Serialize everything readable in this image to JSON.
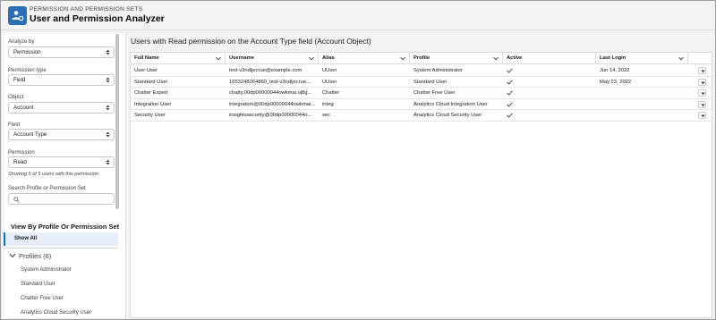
{
  "header": {
    "eyebrow": "PERMISSION AND PERMISSION SETS",
    "title": "User and Permission Analyzer"
  },
  "sidebar": {
    "analyze_by_label": "Analyze by",
    "analyze_by_value": "Permission",
    "permission_type_label": "Permission type",
    "permission_type_value": "Field",
    "object_label": "Object",
    "object_value": "Account",
    "field_label": "Field",
    "field_value": "Account Type",
    "permission_label": "Permission",
    "permission_value": "Read",
    "showing_text": "Showing 5 of 5 users with this permission",
    "search_label": "Search Profile or Permission Set",
    "search_placeholder": "",
    "view_by_title": "View By Profile Or Permission Set",
    "show_all": "Show All",
    "profiles_header": "Profiles (6)",
    "profiles": [
      "System Administrator",
      "Standard User",
      "Chatter Free User",
      "Analytics Cloud Security User"
    ]
  },
  "main": {
    "title": "Users with Read permission on the Account Type field (Account Object)",
    "columns": [
      "Full Name",
      "Username",
      "Alias",
      "Profile",
      "Active",
      "Last Login"
    ],
    "rows": [
      {
        "name": "User User",
        "username": "test-v3ndijecrue@example.com",
        "alias": "UUser",
        "profile": "System Administrator",
        "active": true,
        "last_login": "Jun 14, 2022"
      },
      {
        "name": "Standard User",
        "username": "1653248264860_test-v3ndijecrue...",
        "alias": "UUser",
        "profile": "Standard User",
        "active": true,
        "last_login": "May 23, 2022"
      },
      {
        "name": "Chatter Expert",
        "username": "chatty.00dp00000044owkmai.oj8g...",
        "alias": "Chatter",
        "profile": "Chatter Free User",
        "active": true,
        "last_login": ""
      },
      {
        "name": "Integration User",
        "username": "integration@00dp00000044owkmai...",
        "alias": "integ",
        "profile": "Analytics Cloud Integration User",
        "active": true,
        "last_login": ""
      },
      {
        "name": "Security User",
        "username": "insightssecurity@00dp00000044o...",
        "alias": "sec",
        "profile": "Analytics Cloud Security User",
        "active": true,
        "last_login": ""
      }
    ]
  },
  "colors": {
    "accent": "#0176d3",
    "app_icon": "#2a6fb5",
    "selected_bg": "#e6eefb"
  }
}
